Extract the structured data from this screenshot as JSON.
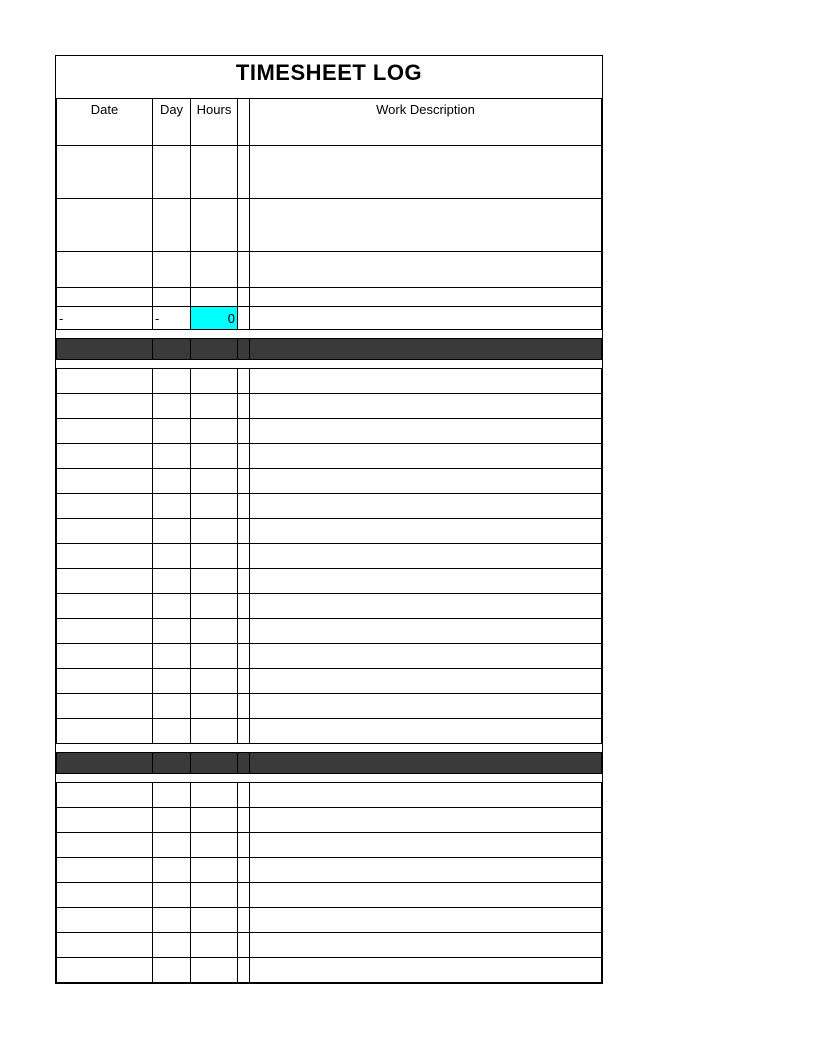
{
  "title": "TIMESHEET LOG",
  "headers": {
    "date": "Date",
    "day": "Day",
    "hours": "Hours",
    "desc": "Work Description"
  },
  "section1": {
    "rows": [
      {
        "date": "",
        "day": "",
        "hours": "",
        "desc": ""
      },
      {
        "date": "",
        "day": "",
        "hours": "",
        "desc": ""
      },
      {
        "date": "",
        "day": "",
        "hours": "",
        "desc": ""
      },
      {
        "date": "",
        "day": "",
        "hours": "",
        "desc": ""
      }
    ],
    "totals": {
      "date": "-",
      "day": "-",
      "hours": "0",
      "desc": ""
    }
  },
  "section2": {
    "rows": [
      {},
      {},
      {},
      {},
      {},
      {},
      {},
      {},
      {},
      {},
      {},
      {},
      {},
      {},
      {}
    ]
  },
  "section3": {
    "rows": [
      {},
      {},
      {},
      {},
      {},
      {},
      {},
      {}
    ]
  }
}
